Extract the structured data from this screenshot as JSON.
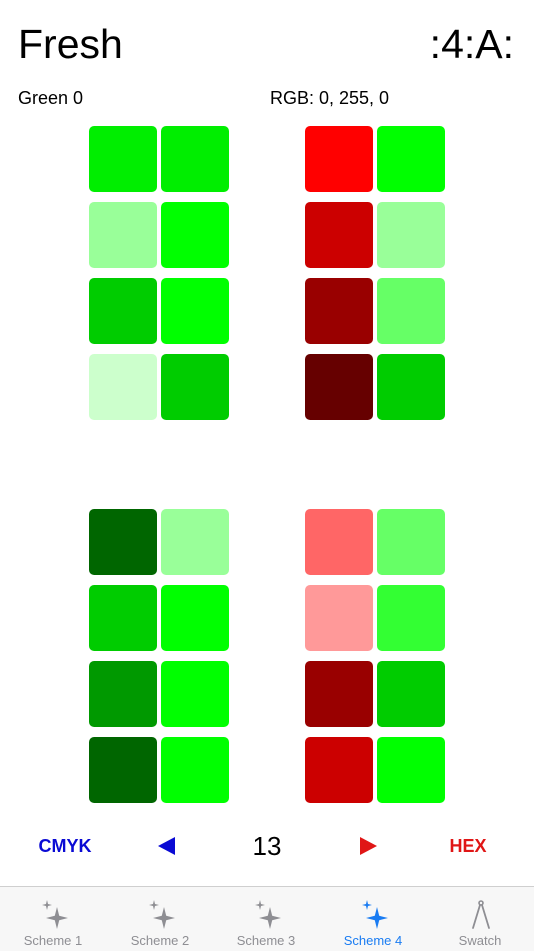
{
  "header": {
    "title": "Fresh",
    "badge": ":4:A:"
  },
  "info": {
    "color_name": "Green 0",
    "rgb": "RGB: 0, 255, 0"
  },
  "swatch_grids": [
    {
      "name": "top-left",
      "cells": [
        [
          "#00ee00",
          "#00ee00"
        ],
        [
          "#99ff99",
          "#00ff00"
        ],
        [
          "#00cc00",
          "#00ff00"
        ],
        [
          "#ccffcc",
          "#00cc00"
        ]
      ]
    },
    {
      "name": "top-right",
      "cells": [
        [
          "#ff0000",
          "#00ff00"
        ],
        [
          "#cc0000",
          "#99ff99"
        ],
        [
          "#990000",
          "#66ff66"
        ],
        [
          "#660000",
          "#00cc00"
        ]
      ]
    },
    {
      "name": "bottom-left",
      "cells": [
        [
          "#006600",
          "#99ff99"
        ],
        [
          "#00cc00",
          "#00ff00"
        ],
        [
          "#009900",
          "#00ff00"
        ],
        [
          "#006600",
          "#00ff00"
        ]
      ]
    },
    {
      "name": "bottom-right",
      "cells": [
        [
          "#ff6666",
          "#66ff66"
        ],
        [
          "#ff9999",
          "#33ff33"
        ],
        [
          "#990000",
          "#00cc00"
        ],
        [
          "#cc0000",
          "#00ff00"
        ]
      ]
    }
  ],
  "controls": {
    "cmyk_label": "CMYK",
    "counter": "13",
    "hex_label": "HEX",
    "prev_icon": "triangle-left-icon",
    "next_icon": "triangle-right-icon",
    "cmyk_color": "#0a0ad4",
    "hex_color": "#e01616"
  },
  "tabs": [
    {
      "label": "Scheme 1",
      "icon": "sparkle-icon",
      "active": false
    },
    {
      "label": "Scheme 2",
      "icon": "sparkle-icon",
      "active": false
    },
    {
      "label": "Scheme 3",
      "icon": "sparkle-icon",
      "active": false
    },
    {
      "label": "Scheme 4",
      "icon": "sparkle-icon",
      "active": true
    },
    {
      "label": "Swatch",
      "icon": "compass-icon",
      "active": false
    }
  ],
  "colors": {
    "tab_inactive": "#8e8e93",
    "tab_active": "#1a7cf2"
  }
}
